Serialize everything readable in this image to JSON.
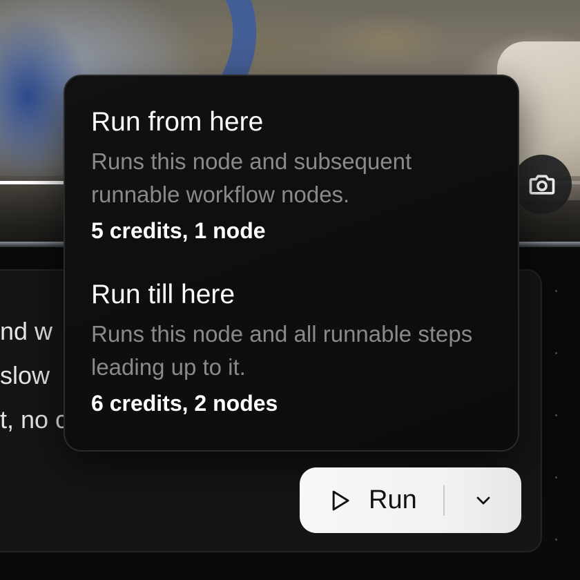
{
  "preview": {
    "progress_fraction": 0.11,
    "camera_icon": "camera-icon"
  },
  "prompt": {
    "lines": [
      "nd w",
      "slow",
      "t, no c"
    ]
  },
  "run_menu": {
    "items": [
      {
        "title": "Run from here",
        "description": "Runs this node and subsequent runnable workflow nodes.",
        "cost": "5 credits, 1 node"
      },
      {
        "title": "Run till here",
        "description": "Runs this node and all runnable steps leading up to it.",
        "cost": "6 credits, 2 nodes"
      }
    ]
  },
  "run_button": {
    "label": "Run",
    "play_icon": "play-icon",
    "chevron_icon": "chevron-down-icon"
  }
}
